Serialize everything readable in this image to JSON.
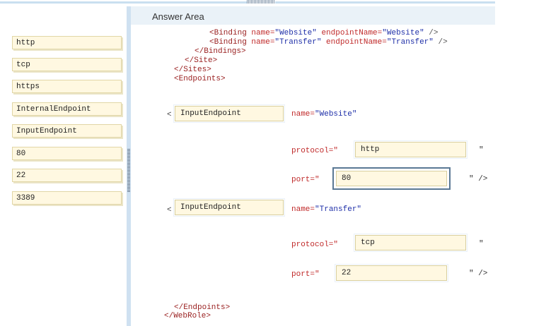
{
  "answer_area_title": "Answer Area",
  "tiles": [
    "http",
    "tcp",
    "https",
    "InternalEndpoint",
    "InputEndpoint",
    "80",
    "22",
    "3389"
  ],
  "code_top": {
    "binding1": {
      "tag": "<Binding",
      "name_attr": " name=",
      "name_val": "\"Website\"",
      "ep_attr": " endpointName=",
      "ep_val": "\"Website\"",
      "close": " />"
    },
    "binding2": {
      "tag": "<Binding",
      "name_attr": " name=",
      "name_val": "\"Transfer\"",
      "ep_attr": " endpointName=",
      "ep_val": "\"Transfer\"",
      "close": " />"
    },
    "bindings_close": "</Bindings>",
    "site_close": "</Site>",
    "sites_close": "</Sites>",
    "endpoints_open": "<Endpoints>"
  },
  "endpoint1": {
    "bracket": "<",
    "element_value": "InputEndpoint",
    "name_attr": "name=",
    "name_val": "\"Website\"",
    "protocol_label": "protocol=\"",
    "protocol_value": "http",
    "protocol_close": "\"",
    "port_label": "port=\"",
    "port_value": "80",
    "port_close": "\" />"
  },
  "endpoint2": {
    "bracket": "<",
    "element_value": "InputEndpoint",
    "name_attr": "name=",
    "name_val": "\"Transfer\"",
    "protocol_label": "protocol=\"",
    "protocol_value": "tcp",
    "protocol_close": "\"",
    "port_label": "port=\"",
    "port_value": "22",
    "port_close": "\" />"
  },
  "code_bottom": {
    "endpoints_close": "</Endpoints>",
    "webrole_close": "</WebRole>"
  }
}
